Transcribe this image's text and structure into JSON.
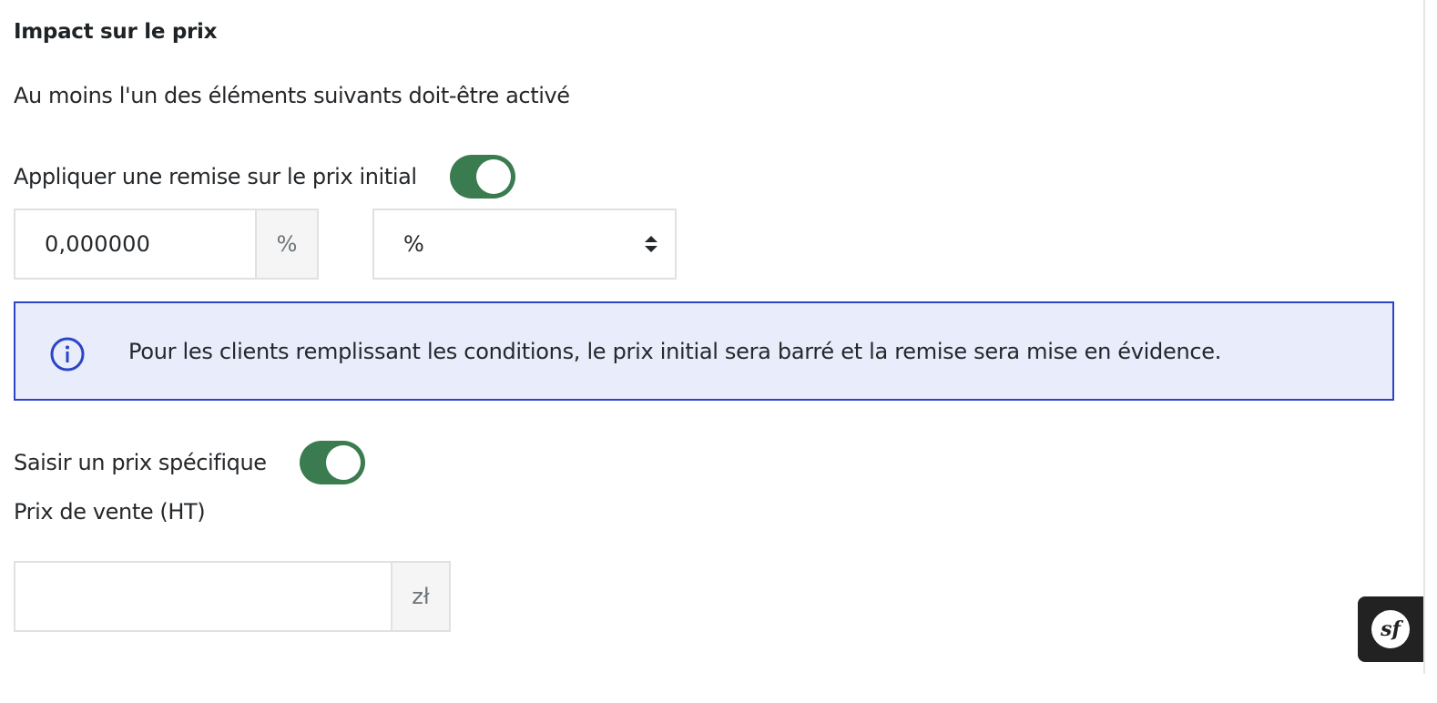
{
  "section": {
    "title": "Impact sur le prix",
    "help": "Au moins l'un des éléments suivants doit-être activé"
  },
  "discount": {
    "toggle_label": "Appliquer une remise sur le prix initial",
    "toggle_on": true,
    "value": "0,000000",
    "value_suffix": "%",
    "type_selected": "%",
    "info_text": "Pour les clients remplissant les conditions, le prix initial sera barré et la remise sera mise en évidence."
  },
  "specific_price": {
    "toggle_label": "Saisir un prix spécifique",
    "toggle_on": true,
    "price_label": "Prix de vente (HT)",
    "price_value": "",
    "currency_suffix": "zł"
  },
  "debug_toolbar": {
    "logo_text": "sf"
  },
  "colors": {
    "toggle_on": "#3a7b4f",
    "info_border": "#2a45c8",
    "info_background": "#e8ecfb",
    "input_border": "#dfe1e3",
    "addon_background": "#f5f5f5",
    "toolbar_background": "#222222"
  },
  "icons": {
    "info": "info-circle-icon",
    "select_caret": "sort-caret-icon",
    "symfony": "symfony-logo-icon"
  }
}
